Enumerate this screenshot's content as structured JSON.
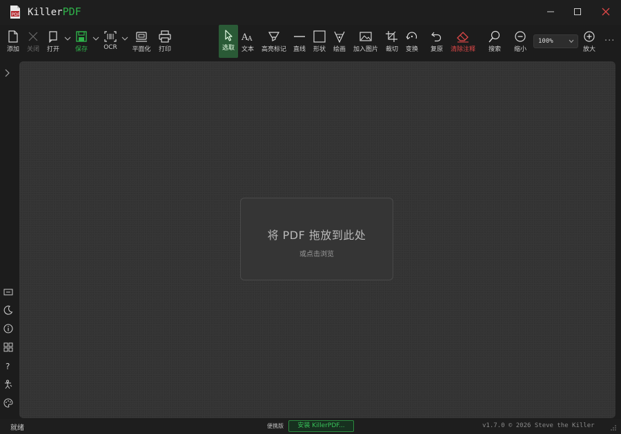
{
  "window": {
    "title_prefix": "Killer",
    "title_accent": "PDF"
  },
  "toolbar": {
    "add": "添加",
    "close": "关闭",
    "open": "打开",
    "save": "保存",
    "ocr": "OCR",
    "flatten": "平面化",
    "print": "打印",
    "select": "选取",
    "text": "文本",
    "highlight": "高亮标记",
    "line": "直线",
    "shape": "形状",
    "draw": "绘画",
    "add_image": "加入图片",
    "crop": "裁切",
    "transform": "变换",
    "undo": "复原",
    "clear_annotations": "清除注释",
    "search": "搜索",
    "zoom_out": "缩小",
    "zoom_level": "100%",
    "zoom_in": "放大",
    "more": "···"
  },
  "drop_zone": {
    "title": "将 PDF 拖放到此处",
    "subtitle": "或点击浏览"
  },
  "status": {
    "state": "就绪",
    "portable_label": "便携版",
    "install_button": "安装 KillerPDF...",
    "version": "v1.7.0  © 2026  Steve the Killer"
  },
  "colors": {
    "accent_green": "#2fb24a",
    "danger_red": "#e04848",
    "canvas_bg": "#333333"
  }
}
